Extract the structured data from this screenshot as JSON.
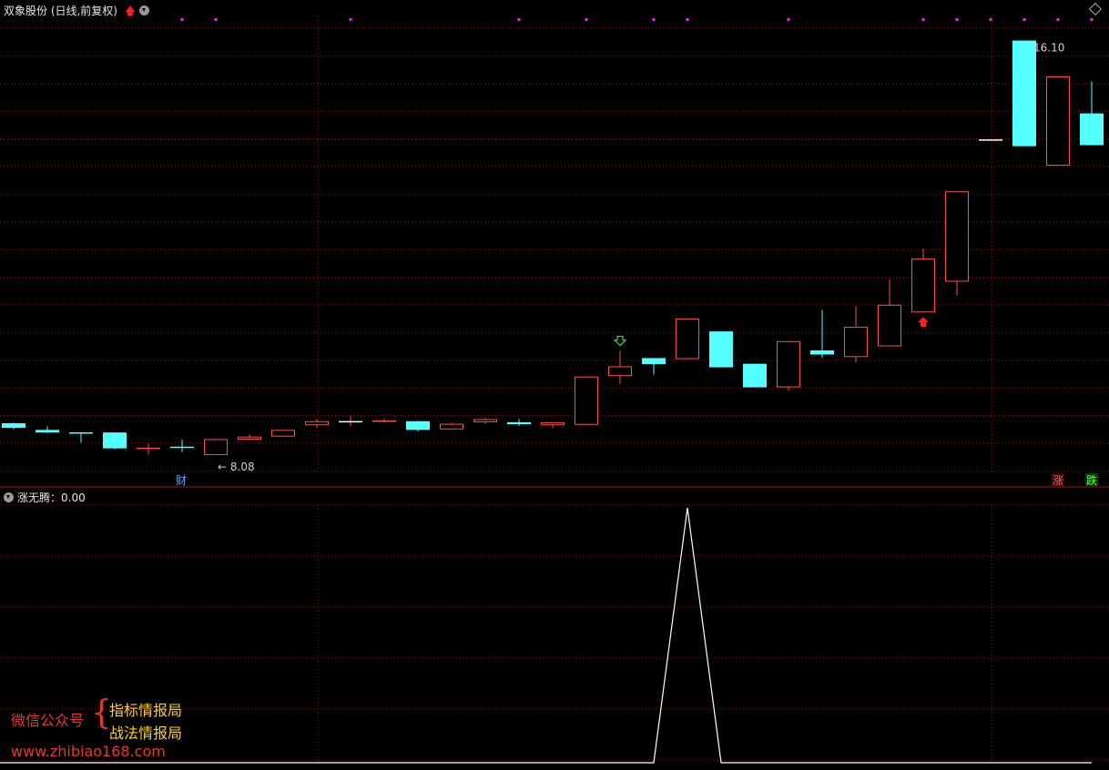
{
  "header": {
    "title": "双象股份 (日线,前复权)",
    "sub_indicator": "涨无腾：0.00"
  },
  "colors": {
    "up": "#ff4d4d",
    "down": "#54ffff",
    "grid": "#8b1a1a",
    "axis": "#b0101a",
    "signal_green": "#33dd33",
    "signal_red": "#ff2020",
    "marker_magenta": "#d838d8",
    "indicator_line": "#ffffff"
  },
  "watermark": {
    "label": "微信公众号",
    "line1": "指标情报局",
    "line2": "战法情报局",
    "url": "www.zhibiao168.com"
  },
  "chart_data": [
    {
      "type": "candlestick",
      "title": "双象股份 (日线,前复权)",
      "ylim": [
        7.7,
        16.5
      ],
      "max_label": "16.10",
      "min_label": "8.08",
      "candles": [
        {
          "o": 8.64,
          "c": 8.55,
          "h": 8.65,
          "l": 8.52
        },
        {
          "o": 8.51,
          "c": 8.46,
          "h": 8.58,
          "l": 8.45
        },
        {
          "o": 8.45,
          "c": 8.44,
          "h": 8.45,
          "l": 8.26
        },
        {
          "o": 8.46,
          "c": 8.15,
          "h": 8.46,
          "l": 8.13
        },
        {
          "o": 8.14,
          "c": 8.15,
          "h": 8.24,
          "l": 8.03
        },
        {
          "o": 8.17,
          "c": 8.15,
          "h": 8.32,
          "l": 8.08
        },
        {
          "o": 8.02,
          "c": 8.33,
          "h": 8.34,
          "l": 8.02
        },
        {
          "o": 8.32,
          "c": 8.38,
          "h": 8.42,
          "l": 8.31
        },
        {
          "o": 8.38,
          "c": 8.51,
          "h": 8.51,
          "l": 8.38
        },
        {
          "o": 8.6,
          "c": 8.68,
          "h": 8.72,
          "l": 8.55
        },
        {
          "o": 8.67,
          "c": 8.67,
          "h": 8.79,
          "l": 8.58
        },
        {
          "o": 8.66,
          "c": 8.68,
          "h": 8.73,
          "l": 8.65
        },
        {
          "o": 8.68,
          "c": 8.51,
          "h": 8.68,
          "l": 8.48
        },
        {
          "o": 8.52,
          "c": 8.63,
          "h": 8.65,
          "l": 8.52
        },
        {
          "o": 8.66,
          "c": 8.72,
          "h": 8.74,
          "l": 8.63
        },
        {
          "o": 8.66,
          "c": 8.62,
          "h": 8.72,
          "l": 8.59
        },
        {
          "o": 8.6,
          "c": 8.66,
          "h": 8.66,
          "l": 8.55
        },
        {
          "o": 8.61,
          "c": 9.55,
          "h": 9.55,
          "l": 8.61
        },
        {
          "o": 9.56,
          "c": 9.75,
          "h": 10.05,
          "l": 9.4
        },
        {
          "o": 9.91,
          "c": 9.79,
          "h": 9.91,
          "l": 9.59
        },
        {
          "o": 9.89,
          "c": 10.68,
          "h": 10.68,
          "l": 9.89
        },
        {
          "o": 10.43,
          "c": 9.73,
          "h": 10.43,
          "l": 9.73
        },
        {
          "o": 9.8,
          "c": 9.34,
          "h": 9.8,
          "l": 9.34
        },
        {
          "o": 9.34,
          "c": 10.24,
          "h": 10.24,
          "l": 9.28
        },
        {
          "o": 10.06,
          "c": 9.98,
          "h": 10.85,
          "l": 9.91
        },
        {
          "o": 9.93,
          "c": 10.52,
          "h": 10.92,
          "l": 9.83
        },
        {
          "o": 10.14,
          "c": 10.95,
          "h": 11.44,
          "l": 10.14
        },
        {
          "o": 10.8,
          "c": 11.85,
          "h": 12.05,
          "l": 10.8
        },
        {
          "o": 11.4,
          "c": 13.16,
          "h": 13.16,
          "l": 11.13
        },
        {
          "o": 14.16,
          "c": 14.16,
          "h": 14.16,
          "l": 14.16
        },
        {
          "o": 16.1,
          "c": 14.04,
          "h": 16.1,
          "l": 14.04
        },
        {
          "o": 13.66,
          "c": 15.4,
          "h": 15.4,
          "l": 13.66
        },
        {
          "o": 14.68,
          "c": 14.06,
          "h": 15.3,
          "l": 14.06
        }
      ],
      "signals": [
        {
          "index": 18,
          "kind": "down-arrow"
        },
        {
          "index": 27,
          "kind": "up-arrow"
        }
      ],
      "markers": {
        "finance_index": 5,
        "finance_label": "财",
        "dot_indices": [
          5,
          6,
          10,
          15,
          17,
          19,
          20,
          23,
          27,
          28,
          29,
          30,
          31,
          32
        ]
      },
      "corner_labels": [
        "涨",
        "跌"
      ]
    },
    {
      "type": "line",
      "title": "涨无腾：0.00",
      "ylim": [
        0,
        1
      ],
      "values": [
        0,
        0,
        0,
        0,
        0,
        0,
        0,
        0,
        0,
        0,
        0,
        0,
        0,
        0,
        0,
        0,
        0,
        0,
        0,
        0,
        1,
        0,
        0,
        0,
        0,
        0,
        0,
        0,
        0,
        0,
        0,
        0,
        0
      ]
    }
  ]
}
